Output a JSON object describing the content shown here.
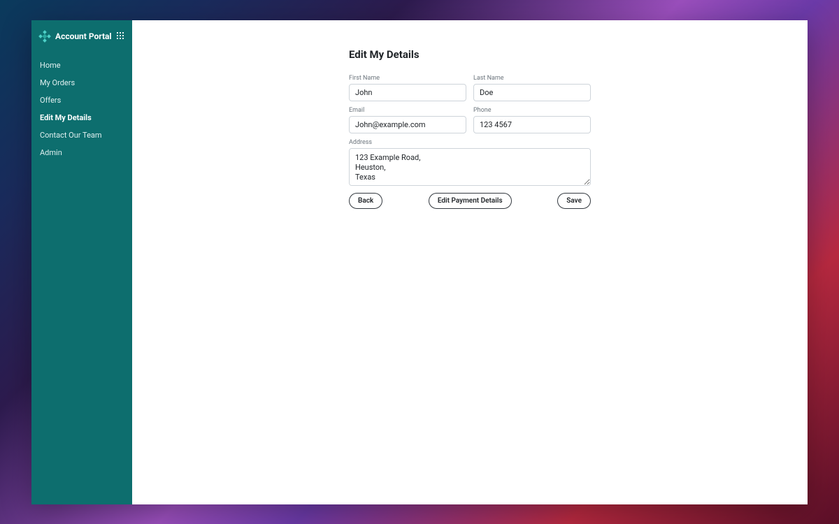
{
  "sidebar": {
    "title": "Account Portal",
    "items": [
      {
        "label": "Home"
      },
      {
        "label": "My Orders"
      },
      {
        "label": "Offers"
      },
      {
        "label": "Edit My Details"
      },
      {
        "label": "Contact Our Team"
      },
      {
        "label": "Admin"
      }
    ],
    "active_index": 3
  },
  "page": {
    "title": "Edit My Details"
  },
  "form": {
    "first_name": {
      "label": "First Name",
      "value": "John"
    },
    "last_name": {
      "label": "Last Name",
      "value": "Doe"
    },
    "email": {
      "label": "Email",
      "value": "John@example.com"
    },
    "phone": {
      "label": "Phone",
      "value": "123 4567"
    },
    "address": {
      "label": "Address",
      "value": "123 Example Road,\nHeuston,\nTexas"
    }
  },
  "buttons": {
    "back": "Back",
    "edit_payment": "Edit Payment Details",
    "save": "Save"
  }
}
